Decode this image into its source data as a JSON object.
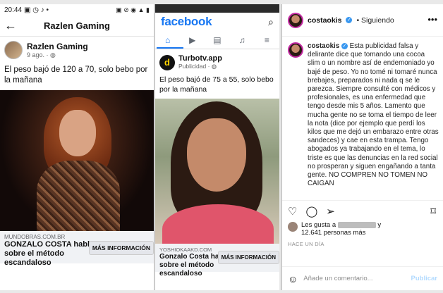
{
  "panel1": {
    "status": {
      "time": "20:44",
      "icons_left": "▣ ◷ ♪ •",
      "icons_right": "▣ ⊘ ◉ ▲ ▮"
    },
    "header": {
      "title": "Razlen Gaming"
    },
    "post": {
      "page_name": "Razlen Gaming",
      "meta": "9 ago. ·",
      "text": "El peso bajó de 120 a 70, solo bebo por la mañana",
      "link_domain": "MUNDOBRAS.COM.BR",
      "link_title": "GONZALO COSTA habló sobre el método escandaloso",
      "link_button": "MÁS INFORMACIÓN"
    }
  },
  "panel2": {
    "logo": "facebook",
    "post": {
      "page_name": "Turbotv.app",
      "meta": "Publicidad · ",
      "logo_letter": "d",
      "text": "El peso bajó de 75 a 55, solo bebo por la mañana",
      "link_domain": "YOSHIOKAAKD.COM",
      "link_title": "Gonzalo Costa habló sobre el método escandaloso",
      "link_button": "MÁS INFORMACIÓN"
    }
  },
  "panel3": {
    "username": "costaokis",
    "follow_state": "• Siguiendo",
    "caption_username": "costaokis",
    "caption": "Esta publicidad falsa y delirante dice que tomando una cocoa slim o un nombre así de endemoniado yo bajé de peso. Yo no tomé ni tomaré nunca brebajes, preparados ni nada q se le parezca. Siempre consulté con médicos y profesionales, es una enfermedad que tengo desde mis 5 años. Lamento que mucha gente no se toma el tiempo de leer la nota (dice por ejemplo que perdí los kilos que me dejó un embarazo entre otras sandeces) y cae en esta trampa. Tengo abogados ya trabajando en el tema, lo triste es que las denuncias en la red social no prosperan y siguen engañando a tanta gente. NO COMPREN NO TOMEN NO CAIGAN",
    "likes_prefix": "Les gusta a",
    "likes_suffix": "y",
    "likes_count": "12.641 personas más",
    "time_ago": "HACE UN DÍA",
    "comment_placeholder": "Añade un comentario...",
    "publish_label": "Publicar"
  }
}
